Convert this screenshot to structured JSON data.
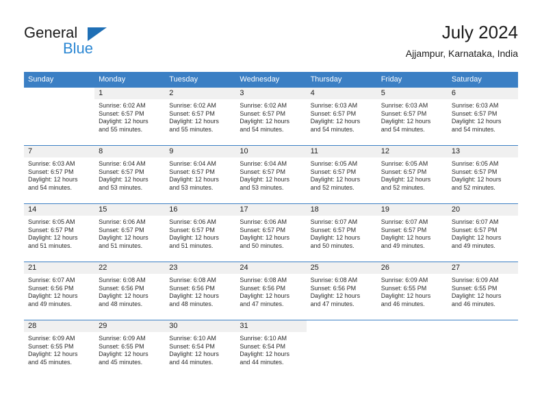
{
  "brand": {
    "word_general": "General",
    "word_blue": "Blue",
    "triangle_color": "#1f6fb5",
    "blue_text_color": "#2b87d3"
  },
  "header": {
    "title": "July 2024",
    "subtitle": "Ajjampur, Karnataka, India"
  },
  "theme": {
    "header_bg": "#3b7fc4",
    "daynum_bg": "#f0f0f0",
    "grid_line": "#3b7fc4",
    "text": "#1a1a1a"
  },
  "calendar": {
    "weekday_headers": [
      "Sunday",
      "Monday",
      "Tuesday",
      "Wednesday",
      "Thursday",
      "Friday",
      "Saturday"
    ],
    "weeks": [
      [
        {
          "day": "",
          "sunrise": "",
          "sunset": "",
          "daylight_line1": "",
          "daylight_line2": "",
          "blank": true
        },
        {
          "day": "1",
          "sunrise": "Sunrise: 6:02 AM",
          "sunset": "Sunset: 6:57 PM",
          "daylight_line1": "Daylight: 12 hours",
          "daylight_line2": "and 55 minutes."
        },
        {
          "day": "2",
          "sunrise": "Sunrise: 6:02 AM",
          "sunset": "Sunset: 6:57 PM",
          "daylight_line1": "Daylight: 12 hours",
          "daylight_line2": "and 55 minutes."
        },
        {
          "day": "3",
          "sunrise": "Sunrise: 6:02 AM",
          "sunset": "Sunset: 6:57 PM",
          "daylight_line1": "Daylight: 12 hours",
          "daylight_line2": "and 54 minutes."
        },
        {
          "day": "4",
          "sunrise": "Sunrise: 6:03 AM",
          "sunset": "Sunset: 6:57 PM",
          "daylight_line1": "Daylight: 12 hours",
          "daylight_line2": "and 54 minutes."
        },
        {
          "day": "5",
          "sunrise": "Sunrise: 6:03 AM",
          "sunset": "Sunset: 6:57 PM",
          "daylight_line1": "Daylight: 12 hours",
          "daylight_line2": "and 54 minutes."
        },
        {
          "day": "6",
          "sunrise": "Sunrise: 6:03 AM",
          "sunset": "Sunset: 6:57 PM",
          "daylight_line1": "Daylight: 12 hours",
          "daylight_line2": "and 54 minutes."
        }
      ],
      [
        {
          "day": "7",
          "sunrise": "Sunrise: 6:03 AM",
          "sunset": "Sunset: 6:57 PM",
          "daylight_line1": "Daylight: 12 hours",
          "daylight_line2": "and 54 minutes."
        },
        {
          "day": "8",
          "sunrise": "Sunrise: 6:04 AM",
          "sunset": "Sunset: 6:57 PM",
          "daylight_line1": "Daylight: 12 hours",
          "daylight_line2": "and 53 minutes."
        },
        {
          "day": "9",
          "sunrise": "Sunrise: 6:04 AM",
          "sunset": "Sunset: 6:57 PM",
          "daylight_line1": "Daylight: 12 hours",
          "daylight_line2": "and 53 minutes."
        },
        {
          "day": "10",
          "sunrise": "Sunrise: 6:04 AM",
          "sunset": "Sunset: 6:57 PM",
          "daylight_line1": "Daylight: 12 hours",
          "daylight_line2": "and 53 minutes."
        },
        {
          "day": "11",
          "sunrise": "Sunrise: 6:05 AM",
          "sunset": "Sunset: 6:57 PM",
          "daylight_line1": "Daylight: 12 hours",
          "daylight_line2": "and 52 minutes."
        },
        {
          "day": "12",
          "sunrise": "Sunrise: 6:05 AM",
          "sunset": "Sunset: 6:57 PM",
          "daylight_line1": "Daylight: 12 hours",
          "daylight_line2": "and 52 minutes."
        },
        {
          "day": "13",
          "sunrise": "Sunrise: 6:05 AM",
          "sunset": "Sunset: 6:57 PM",
          "daylight_line1": "Daylight: 12 hours",
          "daylight_line2": "and 52 minutes."
        }
      ],
      [
        {
          "day": "14",
          "sunrise": "Sunrise: 6:05 AM",
          "sunset": "Sunset: 6:57 PM",
          "daylight_line1": "Daylight: 12 hours",
          "daylight_line2": "and 51 minutes."
        },
        {
          "day": "15",
          "sunrise": "Sunrise: 6:06 AM",
          "sunset": "Sunset: 6:57 PM",
          "daylight_line1": "Daylight: 12 hours",
          "daylight_line2": "and 51 minutes."
        },
        {
          "day": "16",
          "sunrise": "Sunrise: 6:06 AM",
          "sunset": "Sunset: 6:57 PM",
          "daylight_line1": "Daylight: 12 hours",
          "daylight_line2": "and 51 minutes."
        },
        {
          "day": "17",
          "sunrise": "Sunrise: 6:06 AM",
          "sunset": "Sunset: 6:57 PM",
          "daylight_line1": "Daylight: 12 hours",
          "daylight_line2": "and 50 minutes."
        },
        {
          "day": "18",
          "sunrise": "Sunrise: 6:07 AM",
          "sunset": "Sunset: 6:57 PM",
          "daylight_line1": "Daylight: 12 hours",
          "daylight_line2": "and 50 minutes."
        },
        {
          "day": "19",
          "sunrise": "Sunrise: 6:07 AM",
          "sunset": "Sunset: 6:57 PM",
          "daylight_line1": "Daylight: 12 hours",
          "daylight_line2": "and 49 minutes."
        },
        {
          "day": "20",
          "sunrise": "Sunrise: 6:07 AM",
          "sunset": "Sunset: 6:57 PM",
          "daylight_line1": "Daylight: 12 hours",
          "daylight_line2": "and 49 minutes."
        }
      ],
      [
        {
          "day": "21",
          "sunrise": "Sunrise: 6:07 AM",
          "sunset": "Sunset: 6:56 PM",
          "daylight_line1": "Daylight: 12 hours",
          "daylight_line2": "and 49 minutes."
        },
        {
          "day": "22",
          "sunrise": "Sunrise: 6:08 AM",
          "sunset": "Sunset: 6:56 PM",
          "daylight_line1": "Daylight: 12 hours",
          "daylight_line2": "and 48 minutes."
        },
        {
          "day": "23",
          "sunrise": "Sunrise: 6:08 AM",
          "sunset": "Sunset: 6:56 PM",
          "daylight_line1": "Daylight: 12 hours",
          "daylight_line2": "and 48 minutes."
        },
        {
          "day": "24",
          "sunrise": "Sunrise: 6:08 AM",
          "sunset": "Sunset: 6:56 PM",
          "daylight_line1": "Daylight: 12 hours",
          "daylight_line2": "and 47 minutes."
        },
        {
          "day": "25",
          "sunrise": "Sunrise: 6:08 AM",
          "sunset": "Sunset: 6:56 PM",
          "daylight_line1": "Daylight: 12 hours",
          "daylight_line2": "and 47 minutes."
        },
        {
          "day": "26",
          "sunrise": "Sunrise: 6:09 AM",
          "sunset": "Sunset: 6:55 PM",
          "daylight_line1": "Daylight: 12 hours",
          "daylight_line2": "and 46 minutes."
        },
        {
          "day": "27",
          "sunrise": "Sunrise: 6:09 AM",
          "sunset": "Sunset: 6:55 PM",
          "daylight_line1": "Daylight: 12 hours",
          "daylight_line2": "and 46 minutes."
        }
      ],
      [
        {
          "day": "28",
          "sunrise": "Sunrise: 6:09 AM",
          "sunset": "Sunset: 6:55 PM",
          "daylight_line1": "Daylight: 12 hours",
          "daylight_line2": "and 45 minutes."
        },
        {
          "day": "29",
          "sunrise": "Sunrise: 6:09 AM",
          "sunset": "Sunset: 6:55 PM",
          "daylight_line1": "Daylight: 12 hours",
          "daylight_line2": "and 45 minutes."
        },
        {
          "day": "30",
          "sunrise": "Sunrise: 6:10 AM",
          "sunset": "Sunset: 6:54 PM",
          "daylight_line1": "Daylight: 12 hours",
          "daylight_line2": "and 44 minutes."
        },
        {
          "day": "31",
          "sunrise": "Sunrise: 6:10 AM",
          "sunset": "Sunset: 6:54 PM",
          "daylight_line1": "Daylight: 12 hours",
          "daylight_line2": "and 44 minutes."
        },
        {
          "day": "",
          "sunrise": "",
          "sunset": "",
          "daylight_line1": "",
          "daylight_line2": "",
          "blank": true
        },
        {
          "day": "",
          "sunrise": "",
          "sunset": "",
          "daylight_line1": "",
          "daylight_line2": "",
          "blank": true
        },
        {
          "day": "",
          "sunrise": "",
          "sunset": "",
          "daylight_line1": "",
          "daylight_line2": "",
          "blank": true
        }
      ]
    ]
  }
}
